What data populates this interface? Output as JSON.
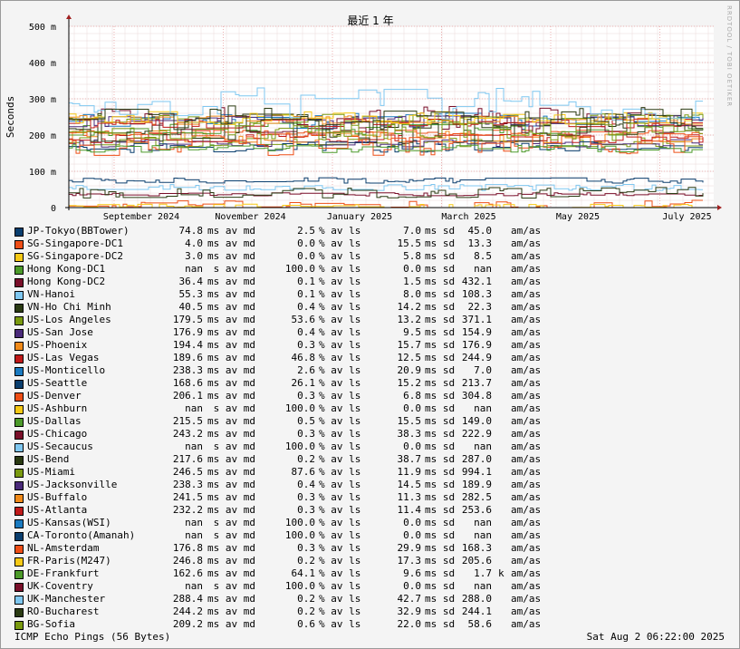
{
  "chart_data": {
    "type": "line",
    "title": "最近 1 年",
    "ylabel": "Seconds",
    "y_ticks": [
      {
        "value": 0,
        "label": "0"
      },
      {
        "value": 0.1,
        "label": "100 m"
      },
      {
        "value": 0.2,
        "label": "200 m"
      },
      {
        "value": 0.3,
        "label": "300 m"
      },
      {
        "value": 0.4,
        "label": "400 m"
      },
      {
        "value": 0.5,
        "label": "500 m"
      }
    ],
    "ylim": [
      0,
      0.5
    ],
    "x_ticks": [
      "September 2024",
      "November 2024",
      "January 2025",
      "March 2025",
      "May 2025",
      "July 2025"
    ],
    "grid": true,
    "legend_position": "bottom"
  },
  "series": [
    {
      "name": "JP-Tokyo(BBTower)",
      "color": "#0a3e6e",
      "avg": "74.8",
      "loss": "2.5",
      "sd": "7.0",
      "amas": "45.0",
      "unit": ""
    },
    {
      "name": "SG-Singapore-DC1",
      "color": "#ee4e16",
      "avg": "4.0",
      "loss": "0.0",
      "sd": "15.5",
      "amas": "13.3",
      "unit": ""
    },
    {
      "name": "SG-Singapore-DC2",
      "color": "#f6c916",
      "avg": "3.0",
      "loss": "0.0",
      "sd": "5.8",
      "amas": "8.5",
      "unit": ""
    },
    {
      "name": "Hong Kong-DC1",
      "color": "#4c9a2a",
      "avg": "nan",
      "loss": "100.0",
      "sd": "0.0",
      "amas": "nan",
      "unit": ""
    },
    {
      "name": "Hong Kong-DC2",
      "color": "#7a0f2a",
      "avg": "36.4",
      "loss": "0.1",
      "sd": "1.5",
      "amas": "432.1",
      "unit": ""
    },
    {
      "name": "VN-Hanoi",
      "color": "#7fc7f0",
      "avg": "55.3",
      "loss": "0.1",
      "sd": "8.0",
      "amas": "108.3",
      "unit": ""
    },
    {
      "name": "VN-Ho Chi Minh",
      "color": "#2a3a12",
      "avg": "40.5",
      "loss": "0.4",
      "sd": "14.2",
      "amas": "22.3",
      "unit": ""
    },
    {
      "name": "US-Los Angeles",
      "color": "#7a9a10",
      "avg": "179.5",
      "loss": "53.6",
      "sd": "13.2",
      "amas": "371.1",
      "unit": ""
    },
    {
      "name": "US-San Jose",
      "color": "#4a2a7a",
      "avg": "176.9",
      "loss": "0.4",
      "sd": "9.5",
      "amas": "154.9",
      "unit": ""
    },
    {
      "name": "US-Phoenix",
      "color": "#f08a1a",
      "avg": "194.4",
      "loss": "0.3",
      "sd": "15.7",
      "amas": "176.9",
      "unit": ""
    },
    {
      "name": "US-Las Vegas",
      "color": "#c01a1a",
      "avg": "189.6",
      "loss": "46.8",
      "sd": "12.5",
      "amas": "244.9",
      "unit": ""
    },
    {
      "name": "US-Monticello",
      "color": "#1a7ac0",
      "avg": "238.3",
      "loss": "2.6",
      "sd": "20.9",
      "amas": "7.0",
      "unit": ""
    },
    {
      "name": "US-Seattle",
      "color": "#0a3e6e",
      "avg": "168.6",
      "loss": "26.1",
      "sd": "15.2",
      "amas": "213.7",
      "unit": ""
    },
    {
      "name": "US-Denver",
      "color": "#ee4e16",
      "avg": "206.1",
      "loss": "0.3",
      "sd": "6.8",
      "amas": "304.8",
      "unit": ""
    },
    {
      "name": "US-Ashburn",
      "color": "#f6c916",
      "avg": "nan",
      "loss": "100.0",
      "sd": "0.0",
      "amas": "nan",
      "unit": ""
    },
    {
      "name": "US-Dallas",
      "color": "#4c9a2a",
      "avg": "215.5",
      "loss": "0.5",
      "sd": "15.5",
      "amas": "149.0",
      "unit": ""
    },
    {
      "name": "US-Chicago",
      "color": "#7a0f2a",
      "avg": "243.2",
      "loss": "0.3",
      "sd": "38.3",
      "amas": "222.9",
      "unit": ""
    },
    {
      "name": "US-Secaucus",
      "color": "#7fc7f0",
      "avg": "nan",
      "loss": "100.0",
      "sd": "0.0",
      "amas": "nan",
      "unit": ""
    },
    {
      "name": "US-Bend",
      "color": "#2a3a12",
      "avg": "217.6",
      "loss": "0.2",
      "sd": "38.7",
      "amas": "287.0",
      "unit": ""
    },
    {
      "name": "US-Miami",
      "color": "#7a9a10",
      "avg": "246.5",
      "loss": "87.6",
      "sd": "11.9",
      "amas": "994.1",
      "unit": ""
    },
    {
      "name": "US-Jacksonville",
      "color": "#4a2a7a",
      "avg": "238.3",
      "loss": "0.4",
      "sd": "14.5",
      "amas": "189.9",
      "unit": ""
    },
    {
      "name": "US-Buffalo",
      "color": "#f08a1a",
      "avg": "241.5",
      "loss": "0.3",
      "sd": "11.3",
      "amas": "282.5",
      "unit": ""
    },
    {
      "name": "US-Atlanta",
      "color": "#c01a1a",
      "avg": "232.2",
      "loss": "0.3",
      "sd": "11.4",
      "amas": "253.6",
      "unit": ""
    },
    {
      "name": "US-Kansas(WSI)",
      "color": "#1a7ac0",
      "avg": "nan",
      "loss": "100.0",
      "sd": "0.0",
      "amas": "nan",
      "unit": ""
    },
    {
      "name": "CA-Toronto(Amanah)",
      "color": "#0a3e6e",
      "avg": "nan",
      "loss": "100.0",
      "sd": "0.0",
      "amas": "nan",
      "unit": ""
    },
    {
      "name": "NL-Amsterdam",
      "color": "#ee4e16",
      "avg": "176.8",
      "loss": "0.3",
      "sd": "29.9",
      "amas": "168.3",
      "unit": ""
    },
    {
      "name": "FR-Paris(M247)",
      "color": "#f6c916",
      "avg": "246.8",
      "loss": "0.2",
      "sd": "17.3",
      "amas": "205.6",
      "unit": ""
    },
    {
      "name": "DE-Frankfurt",
      "color": "#4c9a2a",
      "avg": "162.6",
      "loss": "64.1",
      "sd": "9.6",
      "amas": "1.7",
      "unit": "k"
    },
    {
      "name": "UK-Coventry",
      "color": "#7a0f2a",
      "avg": "nan",
      "loss": "100.0",
      "sd": "0.0",
      "amas": "nan",
      "unit": ""
    },
    {
      "name": "UK-Manchester",
      "color": "#7fc7f0",
      "avg": "288.4",
      "loss": "0.2",
      "sd": "42.7",
      "amas": "288.0",
      "unit": ""
    },
    {
      "name": "RO-Bucharest",
      "color": "#2a3a12",
      "avg": "244.2",
      "loss": "0.2",
      "sd": "32.9",
      "amas": "244.1",
      "unit": ""
    },
    {
      "name": "BG-Sofia",
      "color": "#7a9a10",
      "avg": "209.2",
      "loss": "0.6",
      "sd": "22.0",
      "amas": "58.6",
      "unit": ""
    }
  ],
  "labels": {
    "avg_unit_ok": "ms av md",
    "avg_unit_nan": " s av md",
    "loss_unit": "% av ls",
    "sd_unit": "ms sd",
    "amas_unit": "am/as"
  },
  "footer": {
    "left": "ICMP Echo Pings (56 Bytes)",
    "right": "Sat Aug  2 06:22:00 2025"
  },
  "sidebar_text": "RRDTOOL / TOBI OETIKER"
}
